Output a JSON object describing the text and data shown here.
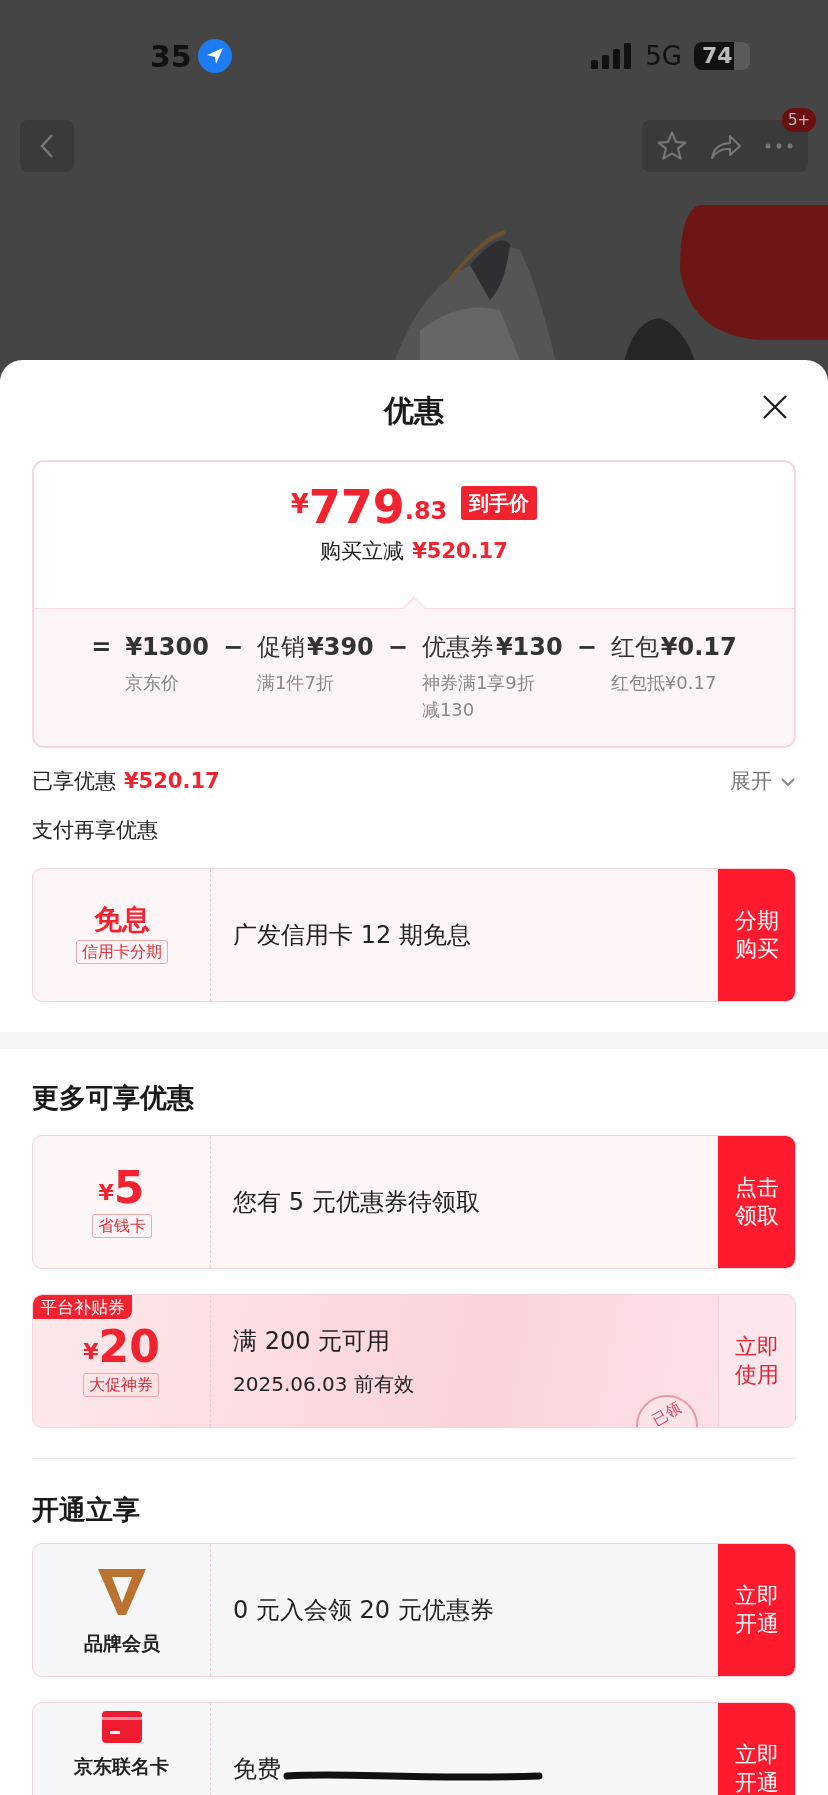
{
  "status_bar": {
    "time": "35",
    "network": "5G",
    "battery": "74"
  },
  "nav": {
    "badge": "5+"
  },
  "sheet": {
    "title": "优惠"
  },
  "price_card": {
    "currency": "¥",
    "price_int": "779",
    "price_dec": ".83",
    "tag": "到手价",
    "saving_label": "购买立减",
    "saving_value": "¥520.17",
    "breakdown": [
      {
        "kind": "op",
        "text": "="
      },
      {
        "kind": "term",
        "value": "¥1300",
        "note": "京东价"
      },
      {
        "kind": "op",
        "text": "−"
      },
      {
        "kind": "term",
        "label": "促销",
        "value": "¥390",
        "note": "满1件7折"
      },
      {
        "kind": "op",
        "text": "−"
      },
      {
        "kind": "term",
        "label": "优惠券",
        "value": "¥130",
        "note": "神券满1享9折减130"
      },
      {
        "kind": "op",
        "text": "−"
      },
      {
        "kind": "term",
        "label": "红包",
        "value": "¥0.17",
        "note": "红包抵¥0.17"
      }
    ]
  },
  "enjoyed": {
    "label": "已享优惠",
    "value": "¥520.17",
    "toggle": "展开"
  },
  "pay_section": {
    "title": "支付再享优惠",
    "cards": [
      {
        "kind": "pay",
        "left": {
          "kind": "text",
          "main": "免息",
          "tag": "信用卡分期"
        },
        "description": "广发信用卡 12 期免息",
        "action": {
          "label": "分期购买",
          "kind": "filled"
        }
      }
    ]
  },
  "more_section": {
    "title": "更多可享优惠",
    "cards": [
      {
        "kind": "pay",
        "left": {
          "kind": "amount",
          "currency": "¥",
          "amount": "5",
          "tag": "省钱卡"
        },
        "description": "您有 5 元优惠券待领取",
        "action": {
          "label": "点击领取",
          "kind": "filled"
        }
      },
      {
        "kind": "promo",
        "ribbon": "平台补贴券",
        "left": {
          "kind": "amount",
          "currency": "¥",
          "amount": "20",
          "tag": "大促神券"
        },
        "description": "满 200 元可用",
        "subtext": "2025.06.03 前有效",
        "stamp": "已领",
        "action": {
          "label": "立即使用",
          "kind": "outline"
        }
      }
    ]
  },
  "member_section": {
    "title": "开通立享",
    "cards": [
      {
        "kind": "membership",
        "left": {
          "kind": "brand",
          "label": "品牌会员"
        },
        "description": "0 元入会领 20 元优惠券",
        "action": {
          "label": "立即开通",
          "kind": "filled"
        }
      },
      {
        "kind": "membership",
        "left": {
          "kind": "card",
          "label": "京东联名卡"
        },
        "description": "免费",
        "redacted": true,
        "action": {
          "label": "立即开通",
          "kind": "filled"
        }
      }
    ]
  }
}
